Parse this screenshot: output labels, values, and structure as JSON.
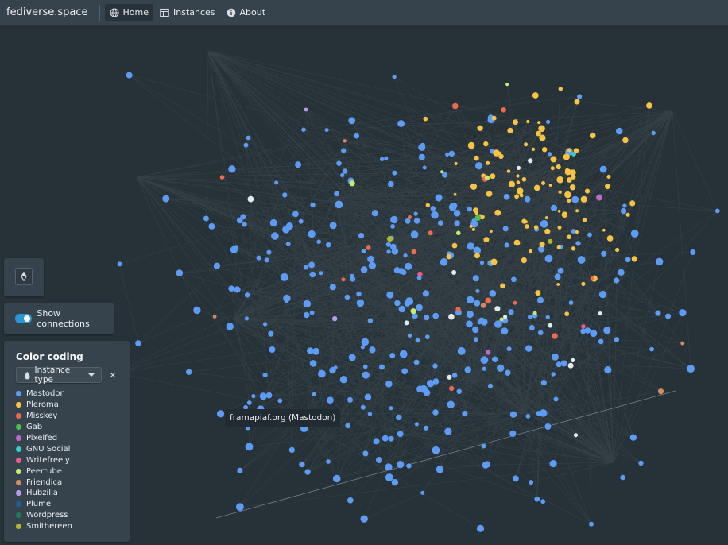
{
  "navbar": {
    "brand": "fediverse.space",
    "items": [
      {
        "label": "Home",
        "icon": "globe-icon",
        "active": true
      },
      {
        "label": "Instances",
        "icon": "table-icon",
        "active": false
      },
      {
        "label": "About",
        "icon": "info-icon",
        "active": false
      }
    ]
  },
  "zoom_control": {
    "icon": "compass-icon"
  },
  "connections": {
    "label": "Show connections",
    "enabled": true
  },
  "color_coding": {
    "title": "Color coding",
    "selected_option": "Instance type",
    "clear_icon": "close-icon",
    "legend": [
      {
        "label": "Mastodon",
        "color": "#5c9cf5"
      },
      {
        "label": "Pleroma",
        "color": "#f8c343"
      },
      {
        "label": "Misskey",
        "color": "#f0694a"
      },
      {
        "label": "Gab",
        "color": "#4ac14d"
      },
      {
        "label": "Pixelfed",
        "color": "#c267cc"
      },
      {
        "label": "GNU Social",
        "color": "#2fd4c5"
      },
      {
        "label": "Writefreely",
        "color": "#f05b8c"
      },
      {
        "label": "Peertube",
        "color": "#c4ec6a"
      },
      {
        "label": "Friendica",
        "color": "#d08c5e"
      },
      {
        "label": "Hubzilla",
        "color": "#b89cf0"
      },
      {
        "label": "Plume",
        "color": "#1e5f9e"
      },
      {
        "label": "Wordpress",
        "color": "#1a7a5e"
      },
      {
        "label": "Smithereen",
        "color": "#b1b62c"
      }
    ]
  },
  "tooltip": {
    "text": "framapiaf.org (Mastodon)"
  },
  "colors": {
    "background": "#263238",
    "panel": "#37434c",
    "accent": "#2b95d6",
    "unknown_node": "#e6e9eb"
  }
}
